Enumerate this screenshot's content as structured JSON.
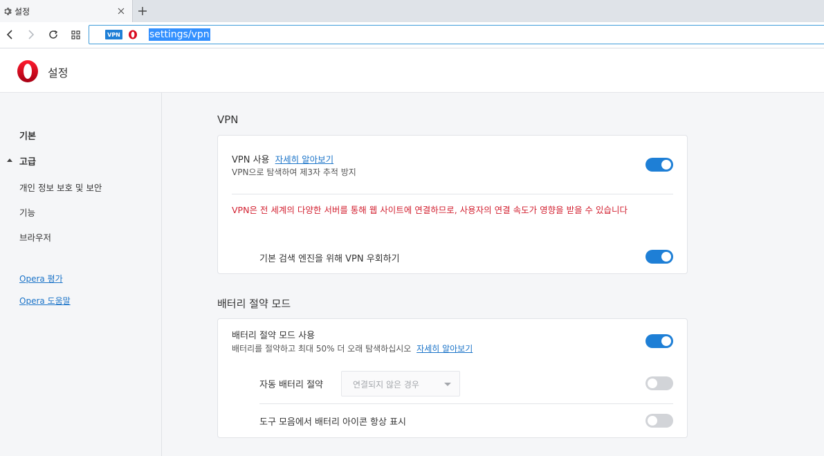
{
  "tab": {
    "title": "설정",
    "icon": "gear-icon"
  },
  "toolbar": {
    "vpn_badge": "VPN",
    "url": "settings/vpn"
  },
  "header": {
    "title": "설정"
  },
  "sidebar": {
    "items": [
      {
        "label": "기본"
      },
      {
        "label": "고급"
      },
      {
        "label": "개인 정보 보호 및 보안"
      },
      {
        "label": "기능"
      },
      {
        "label": "브라우저"
      }
    ],
    "links": [
      {
        "label": "Opera 평가"
      },
      {
        "label": "Opera 도움말"
      }
    ]
  },
  "vpn": {
    "section_title": "VPN",
    "enable_label": "VPN 사용",
    "learn_more": "자세히 알아보기",
    "enable_desc": "VPN으로 탐색하여 제3자 추적 방지",
    "enabled": true,
    "warning": "VPN은 전 세계의 다양한 서버를 통해 웹 사이트에 연결하므로, 사용자의 연결 속도가 영향을 받을 수 있습니다",
    "bypass_label": "기본 검색 엔진을 위해 VPN 우회하기",
    "bypass_enabled": true
  },
  "battery": {
    "section_title": "배터리 절약 모드",
    "enable_label": "배터리 절약 모드 사용",
    "enable_desc": "배터리를 절약하고 최대 50% 더 오래 탐색하십시오",
    "learn_more": "자세히 알아보기",
    "enabled": true,
    "auto_label": "자동 배터리 절약",
    "auto_select_value": "연결되지 않은 경우",
    "auto_enabled": false,
    "icon_label": "도구 모음에서 배터리 아이콘 항상 표시",
    "icon_enabled": false
  },
  "colors": {
    "accent": "#1e7fd6",
    "warning": "#d21f2f",
    "link": "#1a73c8",
    "opera_red": "#d90c20"
  }
}
